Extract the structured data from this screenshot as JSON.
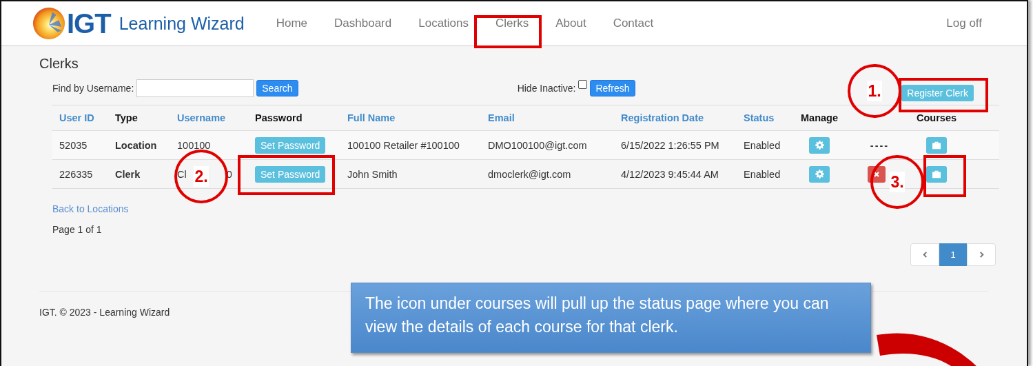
{
  "nav": {
    "logo_text": "IGT",
    "brand": "Learning Wizard",
    "links": [
      "Home",
      "Dashboard",
      "Locations",
      "Clerks",
      "About",
      "Contact"
    ],
    "logoff": "Log off"
  },
  "page_title": "Clerks",
  "search": {
    "label": "Find by Username:",
    "button": "Search"
  },
  "hide_inactive": {
    "label": "Hide Inactive:",
    "checked": false
  },
  "refresh": "Refresh",
  "register": "Register Clerk",
  "table": {
    "columns": [
      {
        "label": "User ID",
        "sortable": true
      },
      {
        "label": "Type",
        "sortable": false
      },
      {
        "label": "Username",
        "sortable": true
      },
      {
        "label": "Password",
        "sortable": false
      },
      {
        "label": "Full Name",
        "sortable": true
      },
      {
        "label": "Email",
        "sortable": true
      },
      {
        "label": "Registration Date",
        "sortable": true
      },
      {
        "label": "Status",
        "sortable": true
      },
      {
        "label": "Manage",
        "sortable": false
      },
      {
        "label": "Courses",
        "sortable": false
      }
    ],
    "rows": [
      {
        "user_id": "52035",
        "type": "Location",
        "username": [
          "100100"
        ],
        "password_button": "Set Password",
        "full_name": "100100 Retailer #100100",
        "email": "DMO100100@igt.com",
        "registration_date": "6/15/2022 1:26:55 PM",
        "status": "Enabled",
        "action": {
          "kind": "dashes",
          "text": "----"
        }
      },
      {
        "user_id": "226335",
        "type": "Clerk",
        "username": [
          "Cl",
          "0"
        ],
        "password_button": "Set Password",
        "full_name": "John Smith",
        "email": "dmoclerk@igt.com",
        "registration_date": "4/12/2023 9:45:44 AM",
        "status": "Enabled",
        "action": {
          "kind": "delete"
        }
      }
    ]
  },
  "back_link": "Back to Locations",
  "page_info": "Page 1 of 1",
  "pagination": [
    {
      "label": "1",
      "selected": true
    }
  ],
  "footer": "IGT. © 2023 - Learning Wizard",
  "annotations": {
    "markers": [
      "1.",
      "2.",
      "3."
    ],
    "callout": "The icon under courses will pull up the status page where you can view the details of each course for that clerk."
  }
}
